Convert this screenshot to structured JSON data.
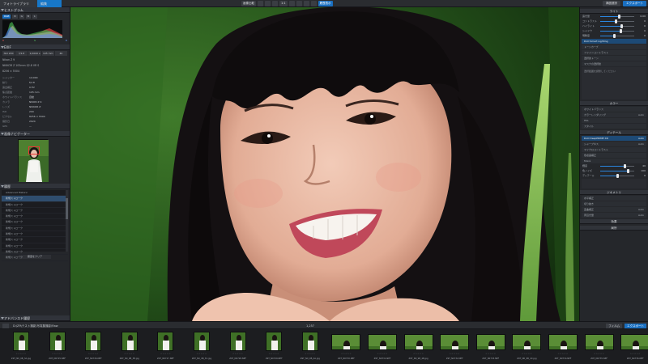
{
  "app": {
    "tab_library": "フォトライブラリ",
    "tab_edit": "編集",
    "toolbar": [
      "画像比較",
      "",
      "",
      "",
      "1:1",
      "",
      "",
      "",
      "",
      "履歴表示"
    ],
    "toolbar_right": [
      "構図選択",
      "エクスポート"
    ],
    "accent": "#1a6fc0"
  },
  "left_panel": {
    "histogram_title": "ヒストグラム",
    "hist_tabs": [
      "RGB",
      "R",
      "G",
      "B",
      "L"
    ],
    "rgb_values": {
      "r": "R",
      "g": "G",
      "b": "B"
    },
    "exif_title": "EXIF",
    "chips": [
      "ISO 200",
      "f/2.8",
      "1/1000 s",
      "105 mm",
      "4K"
    ],
    "info_lines": [
      "Nikon Z 9",
      "NIKKOR Z 105mm f/2.8 VR S",
      "8256 × 5504"
    ],
    "kv": [
      {
        "k": "シャッター",
        "v": "1/1000"
      },
      {
        "k": "絞り",
        "v": "f/2.8"
      },
      {
        "k": "露出補正",
        "v": "0 EV"
      },
      {
        "k": "焦点距離",
        "v": "105 mm"
      },
      {
        "k": "ホワイトバランス",
        "v": "自動"
      },
      {
        "k": "カメラ",
        "v": "NIKON Z 9"
      },
      {
        "k": "レンズ",
        "v": "NIKKOR Z"
      },
      {
        "k": "ISO",
        "v": "200"
      },
      {
        "k": "ピクセル",
        "v": "8256 × 5504"
      },
      {
        "k": "撮影日",
        "v": "2024"
      },
      {
        "k": "GPS",
        "v": "—"
      }
    ],
    "navigator_title": "画像ナビゲーター",
    "history_title": "履歴",
    "history_items": [
      "Advanced Historic",
      "新規ストローク",
      "新規ストローク",
      "新規ストローク",
      "新規ストローク",
      "新規ストローク",
      "新規ストローク",
      "新規ストローク",
      "新規ストローク",
      "新規ストローク",
      "新規ストローク",
      "新規ストローク"
    ],
    "history_button": "履歴をクリア",
    "footer": "アドバンスド履歴"
  },
  "right_panel": {
    "sections": {
      "light": "ライト",
      "color": "カラー",
      "detail": "ディテール",
      "geometry": "ジオメトリ"
    },
    "light_rows": [
      {
        "label": "DxO Smart Lighting",
        "value": ""
      },
      {
        "label": "トーンカーブ",
        "value": ""
      },
      {
        "label": "ファインコントラスト",
        "value": ""
      },
      {
        "label": "選択的トーン",
        "value": ""
      }
    ],
    "light_sliders": [
      {
        "name": "露光量",
        "value": "0.00",
        "pos": 0.55
      },
      {
        "name": "コントラスト",
        "value": "0",
        "pos": 0.45
      },
      {
        "name": "ハイライト",
        "value": "0",
        "pos": 0.62
      },
      {
        "name": "シャドウ",
        "value": "0",
        "pos": 0.6
      },
      {
        "name": "明瞭度",
        "value": "0",
        "pos": 0.4
      }
    ],
    "mask_title": "マスクの選択肢",
    "mask_text": "選択範囲を調整してください",
    "color_rows": [
      {
        "label": "ホワイトバランス",
        "value": ""
      },
      {
        "label": "カラーレンダリング",
        "value": "Auto"
      },
      {
        "label": "HSL",
        "value": ""
      },
      {
        "label": "スタイル",
        "value": ""
      }
    ],
    "detail_rows": [
      {
        "label": "DxO DeepPRIME XD",
        "value": "Auto"
      },
      {
        "label": "シャープネス",
        "value": "Auto"
      },
      {
        "label": "マイクロコントラスト",
        "value": ""
      },
      {
        "label": "色収差補正",
        "value": ""
      },
      {
        "label": "Moiré",
        "value": ""
      }
    ],
    "detail_sliders": [
      {
        "name": "輝度",
        "value": "40",
        "pos": 0.72
      },
      {
        "name": "色ノイズ",
        "value": "100",
        "pos": 0.8
      },
      {
        "name": "ディテール",
        "value": "0",
        "pos": 0.5
      }
    ],
    "geometry_rows": [
      {
        "label": "水平補正",
        "value": ""
      },
      {
        "label": "切り抜き",
        "value": ""
      },
      {
        "label": "歪曲補正",
        "value": "Auto"
      },
      {
        "label": "周辺光量",
        "value": "Auto"
      }
    ],
    "bottom_sections": [
      "効果",
      "局所"
    ]
  },
  "filmstrip": {
    "path": "D:\\Z9\\テスト撮影\\写真集撮影\\Raw",
    "count": "1,257",
    "right_buttons": [
      "フィルム",
      "エクスポート"
    ],
    "items": [
      {
        "name": "Z9T_N0_9B_3A.jpg",
        "land": false
      },
      {
        "name": "Z9T_N0725.NEF",
        "land": false
      },
      {
        "name": "Z9T_N0726.NEF",
        "land": false
      },
      {
        "name": "Z9T_N0_9B_3B.jpg",
        "land": false
      },
      {
        "name": "Z9T_N0727.NEF",
        "land": false
      },
      {
        "name": "Z9T_N0_9B_3C.jpg",
        "land": false
      },
      {
        "name": "Z9T_N0728.NEF",
        "land": false
      },
      {
        "name": "Z9T_N0729.NEF",
        "land": false
      },
      {
        "name": "Z9T_N0_9B_4A.jpg",
        "land": false
      },
      {
        "name": "Z9T_N0730.NEF",
        "land": true
      },
      {
        "name": "Z9T_N0731.NEF",
        "land": true
      },
      {
        "name": "Z9T_N0_9B_4B.jpg",
        "land": true
      },
      {
        "name": "Z9T_N0732.NEF",
        "land": true
      },
      {
        "name": "Z9T_N0733.NEF",
        "land": true
      },
      {
        "name": "Z9T_N0_9B_4C.jpg",
        "land": true
      },
      {
        "name": "Z9T_N0734.NEF",
        "land": true
      },
      {
        "name": "Z9T_N0735.NEF",
        "land": true
      },
      {
        "name": "Z9T_N0736.NEF",
        "land": true
      }
    ]
  }
}
